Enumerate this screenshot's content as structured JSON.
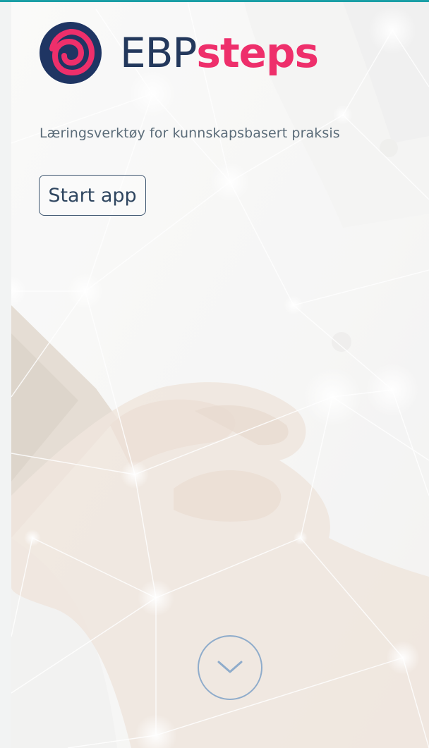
{
  "brand": {
    "name_light": "EBP",
    "name_bold": "steps",
    "logo_icon": "swirl-logo-icon",
    "colors": {
      "navy": "#23385c",
      "pink": "#ee2f6b",
      "accent": "#1a9fa6"
    }
  },
  "hero": {
    "tagline": "Læringsverktøy for kunnskapsbasert praksis",
    "start_label": "Start app",
    "scroll_icon": "chevron-down-icon"
  }
}
